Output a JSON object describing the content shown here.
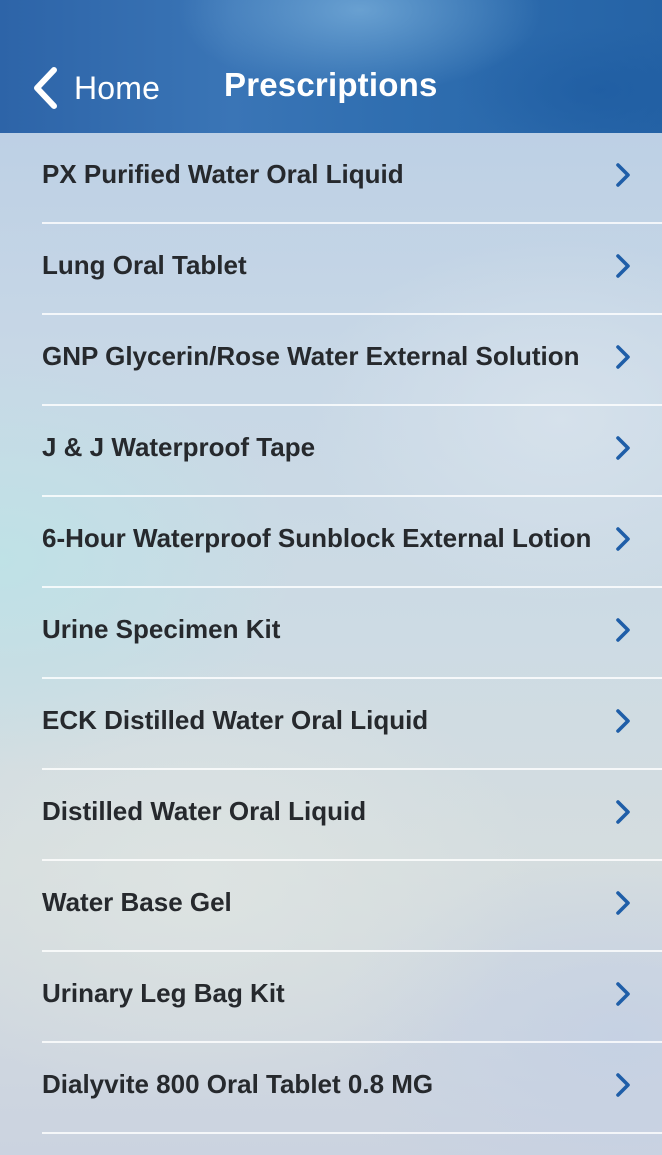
{
  "nav": {
    "back_label": "Home",
    "title": "Prescriptions",
    "back_icon": "chevron-left-icon"
  },
  "colors": {
    "header_blue": "#2f6eb0",
    "chevron_blue": "#1f5ea8",
    "text_dark": "#26292d",
    "header_text": "#ffffff"
  },
  "prescriptions": {
    "items": [
      {
        "label": "PX Purified Water Oral Liquid"
      },
      {
        "label": "Lung Oral Tablet"
      },
      {
        "label": "GNP Glycerin/Rose Water External Solution"
      },
      {
        "label": "J & J Waterproof Tape"
      },
      {
        "label": "6-Hour Waterproof Sunblock External Lotion"
      },
      {
        "label": "Urine Specimen Kit"
      },
      {
        "label": "ECK Distilled Water Oral Liquid"
      },
      {
        "label": "Distilled Water Oral Liquid"
      },
      {
        "label": "Water Base Gel"
      },
      {
        "label": "Urinary Leg Bag Kit"
      },
      {
        "label": "Dialyvite 800 Oral Tablet 0.8 MG"
      }
    ]
  }
}
